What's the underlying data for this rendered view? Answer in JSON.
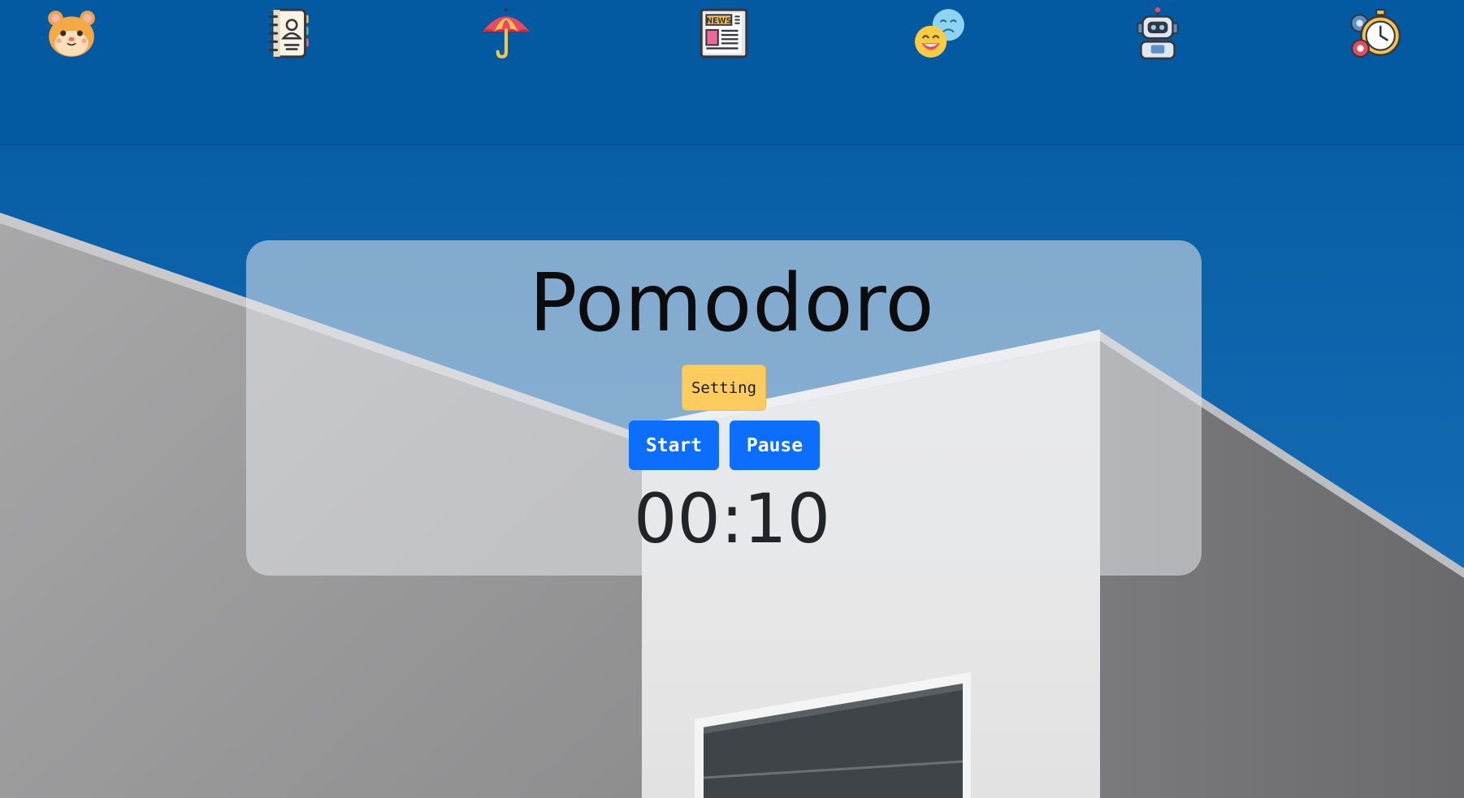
{
  "nav": {
    "icons": [
      "hamster-icon",
      "contacts-book-icon",
      "umbrella-icon",
      "newspaper-icon",
      "emotions-icon",
      "robot-icon",
      "stopwatch-settings-icon"
    ],
    "newspaper_label": "NEWS"
  },
  "card": {
    "title": "Pomodoro",
    "setting_label": "Setting",
    "start_label": "Start",
    "pause_label": "Pause",
    "timer": "00:10"
  },
  "colors": {
    "nav_bg": "#045aa0",
    "sky": "#0b5aa3",
    "primary_button": "#0d6efd",
    "setting_button": "#fdcb5e",
    "wall": "#9a9a9b"
  }
}
